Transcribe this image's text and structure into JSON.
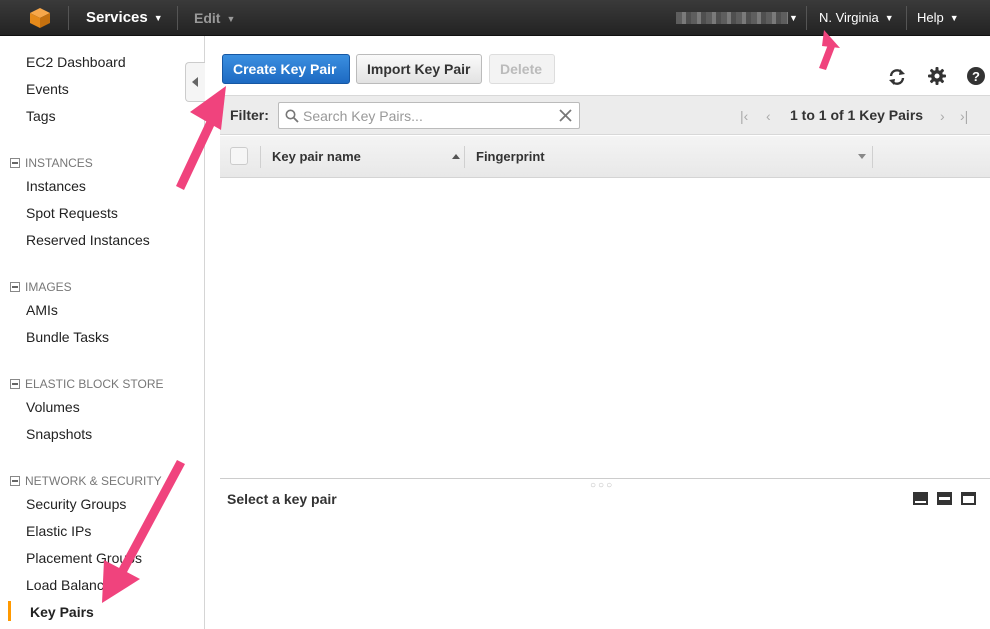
{
  "topbar": {
    "services_label": "Services",
    "edit_label": "Edit",
    "region_label": "N. Virginia",
    "help_label": "Help"
  },
  "sidebar": {
    "ec2_dashboard": "EC2 Dashboard",
    "events": "Events",
    "tags": "Tags",
    "instances_header": "INSTANCES",
    "instances": "Instances",
    "spot_requests": "Spot Requests",
    "reserved_instances": "Reserved Instances",
    "images_header": "IMAGES",
    "amis": "AMIs",
    "bundle_tasks": "Bundle Tasks",
    "ebs_header": "ELASTIC BLOCK STORE",
    "volumes": "Volumes",
    "snapshots": "Snapshots",
    "network_header": "NETWORK & SECURITY",
    "security_groups": "Security Groups",
    "elastic_ips": "Elastic IPs",
    "placement_groups": "Placement Groups",
    "load_balancers": "Load Balancers",
    "key_pairs": "Key Pairs"
  },
  "toolbar": {
    "create_label": "Create Key Pair",
    "import_label": "Import Key Pair",
    "delete_label": "Delete"
  },
  "filter": {
    "label": "Filter:",
    "placeholder": "Search Key Pairs...",
    "value": "",
    "pager_text": "1 to 1 of 1 Key Pairs"
  },
  "table": {
    "columns": [
      "Key pair name",
      "Fingerprint"
    ]
  },
  "detail": {
    "title": "Select a key pair"
  },
  "colors": {
    "primary_button": "#1d6ac2",
    "active_nav_marker": "#ff9900",
    "annotation_arrow": "#f0437d"
  }
}
